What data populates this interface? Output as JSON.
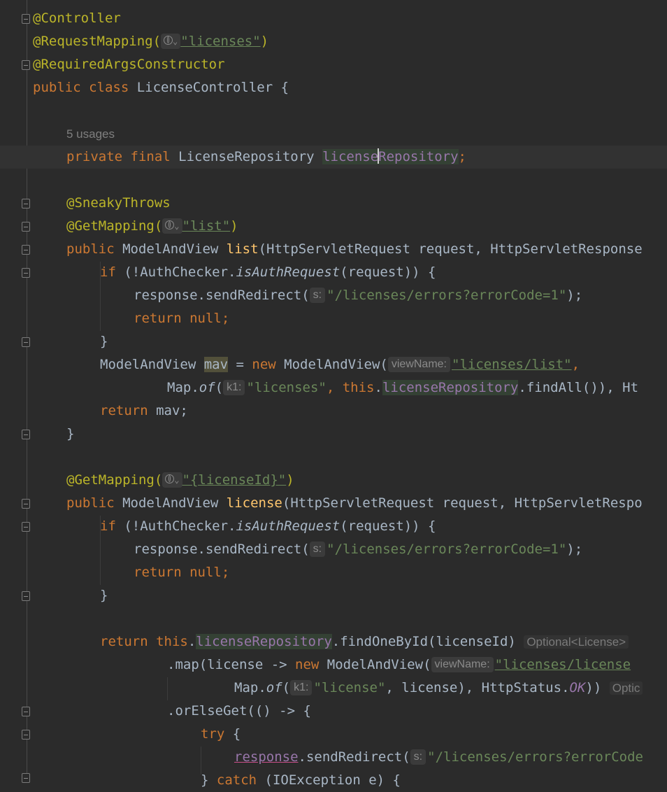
{
  "editor": {
    "lines": {
      "l1": "@Controller",
      "l2_ann": "@RequestMapping(",
      "l2_str": "\"licenses\"",
      "l2_close": ")",
      "l3": "@RequiredArgsConstructor",
      "l4_kw": "public class ",
      "l4_name": "LicenseController {",
      "usages": "5 usages",
      "l6_kw": "private final ",
      "l6_type": "LicenseRepository ",
      "l6_field_a": "license",
      "l6_field_b": "Repository",
      "l6_semi": ";",
      "l8": "@SneakyThrows",
      "l9_ann": "@GetMapping(",
      "l9_str": "\"list\"",
      "l9_close": ")",
      "l10_kw": "public ",
      "l10_type": "ModelAndView ",
      "l10_name": "list",
      "l10_args": "(HttpServletRequest request, HttpServletResponse",
      "if_kw": "if ",
      "if_a": "(!AuthChecker.",
      "if_m": "isAuthRequest",
      "if_b": "(request)) {",
      "redirect_a": "response.sendRedirect(",
      "hint_s": "s:",
      "redirect_str": "\"/licenses/errors?errorCode=1\"",
      "redirect_b": ");",
      "ret_kw": "return ",
      "ret_null": "null;",
      "brace": "}",
      "mav_type": "ModelAndView ",
      "mav_var": "mav",
      "mav_eq": " = ",
      "new_kw": "new ",
      "mav_ctor": "ModelAndView(",
      "hint_view": "viewName:",
      "mav_str": "\"licenses/list\"",
      "comma": ",",
      "map_a": "Map.",
      "map_of": "of",
      "map_paren": "(",
      "hint_k1": "k1:",
      "map_str": "\"licenses\"",
      "map_comma": ", ",
      "this_kw": "this",
      "dot": ".",
      "repo_field": "licenseRepository",
      "find_all": ".findAll()), Ht",
      "ret_mav": "mav;",
      "brace_close": "}",
      "gm2_ann": "@GetMapping(",
      "gm2_str": "\"{licenseId}\"",
      "gm2_close": ")",
      "l20_name": "license",
      "l20_args": "(HttpServletRequest request, HttpServletRespo",
      "find_one": ".findOneById(licenseId)",
      "inlay_opt": "Optional<License>",
      "map_line_a": ".map(license -> ",
      "map_line_ctor": "ModelAndView(",
      "map_line_str": "\"licenses/license",
      "of_str": "\"license\"",
      "of_rest_a": ", license), HttpStatus.",
      "ok": "OK",
      "of_rest_b": "))",
      "inlay_opt2": "Optic",
      "or_else": ".orElseGet(() -> {",
      "try_kw": "try ",
      "try_brace": "{",
      "resp_err": "response",
      "send_redir": ".sendRedirect(",
      "redirect_str2": "\"/licenses/errors?errorCode",
      "catch_a": "} ",
      "catch_kw": "catch ",
      "catch_b": "(IOException e) {"
    }
  }
}
